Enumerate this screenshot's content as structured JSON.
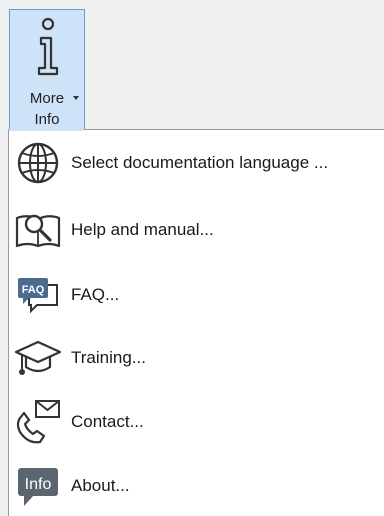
{
  "ribbon": {
    "more_info": {
      "label_line1": "More",
      "label_line2": "Info"
    }
  },
  "menu": {
    "items": [
      {
        "label": "Select documentation language ...",
        "icon": "globe-icon"
      },
      {
        "label": "Help and manual...",
        "icon": "help-manual-icon"
      },
      {
        "label": "FAQ...",
        "icon": "faq-icon",
        "icon_text": "FAQ"
      },
      {
        "label": "Training...",
        "icon": "graduation-cap-icon"
      },
      {
        "label": "Contact...",
        "icon": "contact-icon"
      },
      {
        "label": "About...",
        "icon": "info-bubble-icon",
        "icon_text": "Info"
      }
    ]
  },
  "colors": {
    "button_highlight_bg": "#cde3f7",
    "button_highlight_border": "#5aa0dc",
    "menu_bg": "#ffffff",
    "info_bubble": "#5a6570"
  }
}
